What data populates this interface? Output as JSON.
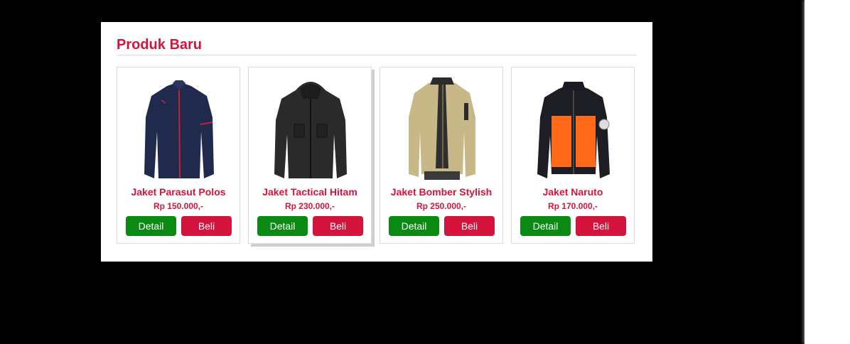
{
  "section": {
    "title": "Produk Baru"
  },
  "products": [
    {
      "name": "Jaket Parasut Polos",
      "price": "Rp 150.000,-",
      "detail_label": "Detail",
      "buy_label": "Beli",
      "icon": "navy-windbreaker-jacket-image"
    },
    {
      "name": "Jaket Tactical Hitam",
      "price": "Rp 230.000,-",
      "detail_label": "Detail",
      "buy_label": "Beli",
      "icon": "black-tactical-hooded-jacket-image"
    },
    {
      "name": "Jaket Bomber Stylish",
      "price": "Rp 250.000,-",
      "detail_label": "Detail",
      "buy_label": "Beli",
      "icon": "khaki-bomber-jacket-image"
    },
    {
      "name": "Jaket Naruto",
      "price": "Rp 170.000,-",
      "detail_label": "Detail",
      "buy_label": "Beli",
      "icon": "orange-black-naruto-jacket-image"
    }
  ],
  "colors": {
    "accent": "#d4143c",
    "detail_button": "#0a8a12",
    "buy_button": "#d4143c",
    "page_background": "#000000",
    "panel_background": "#ffffff"
  }
}
